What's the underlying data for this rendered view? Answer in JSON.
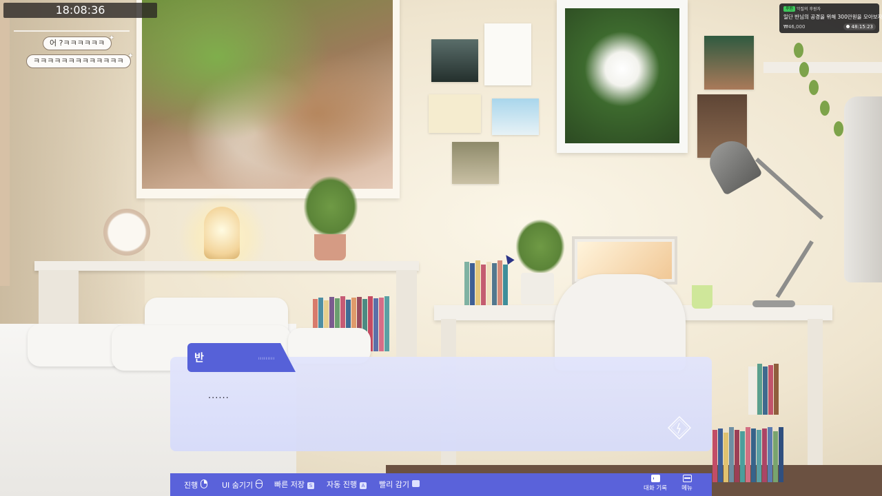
{
  "hud": {
    "clock_time": "18:08:36"
  },
  "chat": {
    "messages": [
      {
        "text": "어 ?ㅋㅋㅋㅋㅋㅋ"
      },
      {
        "text": "ㅋㅋㅋㅋㅋㅋㅋㅋㅋㅋㅋㅋㅋ"
      }
    ]
  },
  "donation": {
    "tag": "후원",
    "sender": "악질의 후원자",
    "message": "일단 반님의 공경을 위해 300만원을 모아보자",
    "amount": "₩46,000",
    "timer": "48:15:23"
  },
  "dialog": {
    "speaker": "반",
    "speaker_sub": "ııııııııı",
    "line": "......"
  },
  "menu": {
    "items": [
      {
        "label": "진행",
        "key": "mouse-click"
      },
      {
        "label": "UI 숨기기",
        "key": "mouse-wheel"
      },
      {
        "label": "빠른 저장",
        "key": "S"
      },
      {
        "label": "자동 진행",
        "key": "A"
      },
      {
        "label": "빨리 감기",
        "key": "Ctrl"
      }
    ],
    "log_label": "대화 기록",
    "menu_label": "메뉴"
  },
  "colors": {
    "accent": "#5a62da",
    "name_tag": "#5661d8",
    "dialog_bg": "#dfe2fb"
  },
  "icons": {
    "advance": "diamond-arrow-icon",
    "log": "chat-bubble-icon",
    "menu": "window-icon"
  }
}
